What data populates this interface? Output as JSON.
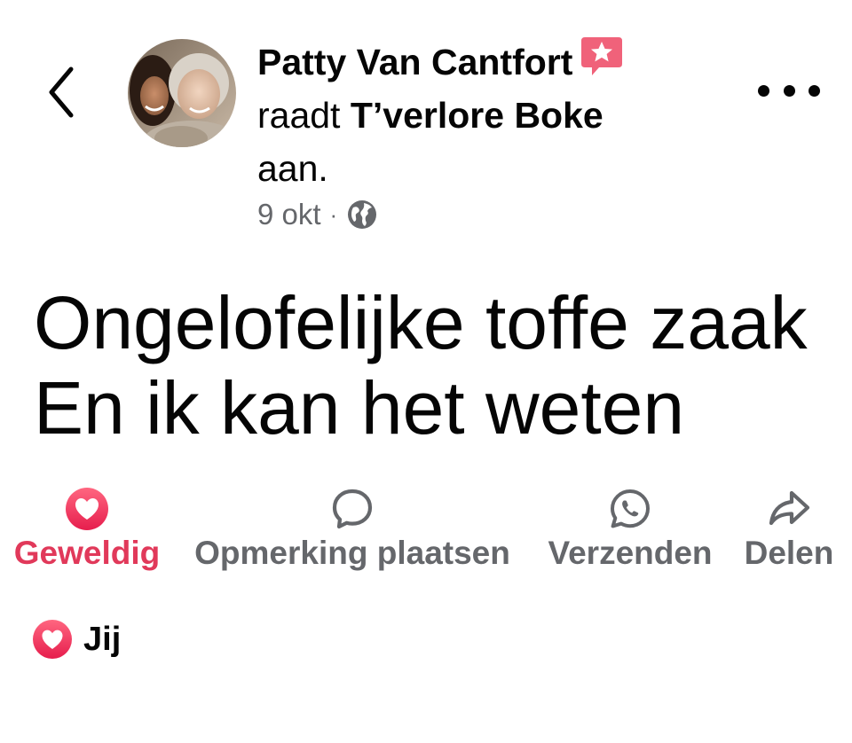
{
  "header": {
    "author_name": "Patty Van Cantfort",
    "verb": "raadt",
    "page_name": "T’verlore Boke",
    "suffix": "aan.",
    "timestamp": "9 okt",
    "separator": "·",
    "badge_icon": "recommendation-star-icon",
    "privacy_icon": "globe-icon",
    "back_icon": "chevron-left-icon",
    "more_icon": "more-dots-icon"
  },
  "post": {
    "lines": [
      "Ongelofelijke toffe zaak",
      "En ik kan het weten"
    ]
  },
  "actions": [
    {
      "label": "Geweldig",
      "icon": "heart-icon",
      "active": true
    },
    {
      "label": "Opmerking plaatsen",
      "icon": "comment-bubble-icon",
      "active": false
    },
    {
      "label": "Verzenden",
      "icon": "whatsapp-icon",
      "active": false
    },
    {
      "label": "Delen",
      "icon": "share-arrow-icon",
      "active": false
    }
  ],
  "reactions": {
    "icon": "heart-icon",
    "who": "Jij"
  },
  "colors": {
    "accent_love": "#e1395a",
    "secondary_text": "#65676b",
    "primary_text": "#050505"
  }
}
